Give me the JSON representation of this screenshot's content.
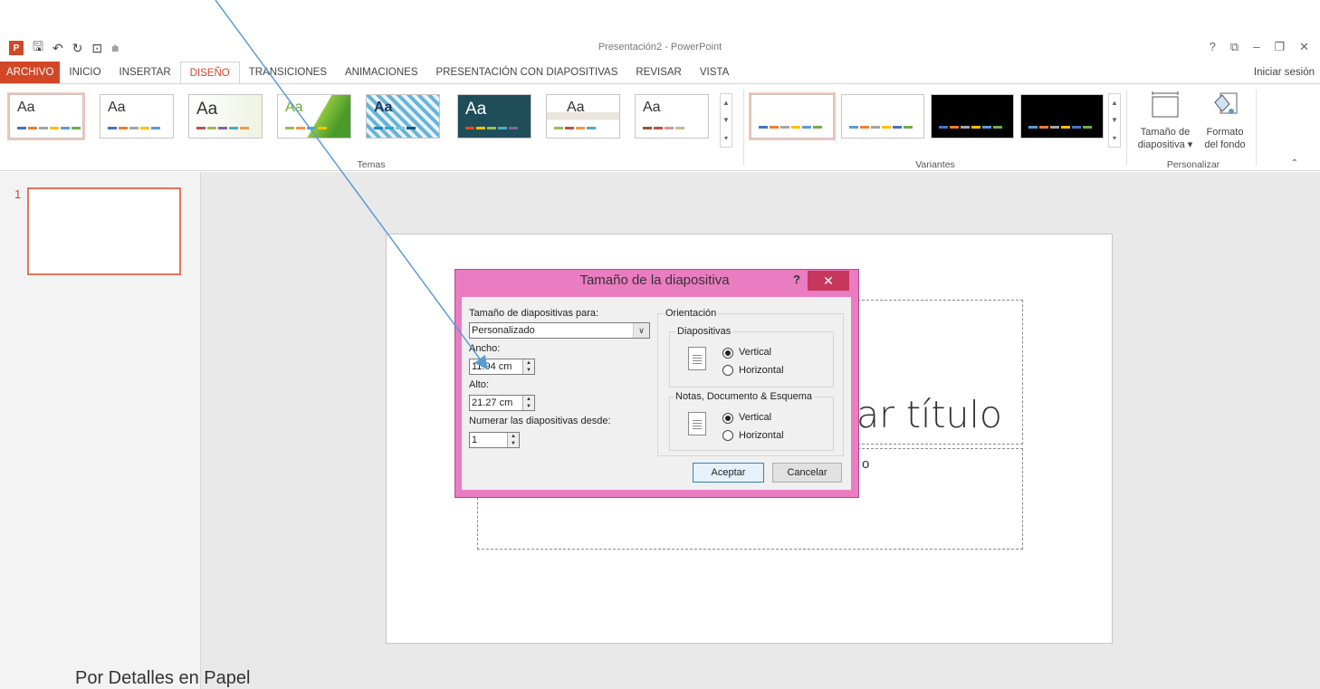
{
  "window": {
    "title": "Presentación2 - PowerPoint",
    "controls": [
      "?",
      "⧉",
      "–",
      "❐",
      "✕"
    ],
    "signin_label": "Iniciar sesión"
  },
  "quick_access": {
    "app_icon": "P",
    "icons": [
      "save-icon",
      "undo-icon",
      "redo-icon",
      "present-icon",
      "customize-icon"
    ]
  },
  "tabs": [
    {
      "label": "ARCHIVO"
    },
    {
      "label": "INICIO"
    },
    {
      "label": "INSERTAR"
    },
    {
      "label": "DISEÑO"
    },
    {
      "label": "TRANSICIONES"
    },
    {
      "label": "ANIMACIONES"
    },
    {
      "label": "PRESENTACIÓN CON DIAPOSITIVAS"
    },
    {
      "label": "REVISAR"
    },
    {
      "label": "VISTA"
    }
  ],
  "ribbon": {
    "themes_label": "Temas",
    "variants_label": "Variantes",
    "customize_label": "Personalizar",
    "theme_aa": "Aa",
    "slide_size_label_1": "Tamaño de",
    "slide_size_label_2": "diapositiva ▾",
    "format_bg_label_1": "Formato",
    "format_bg_label_2": "del fondo"
  },
  "slides_panel": {
    "slide_number": "1"
  },
  "slide": {
    "title_placeholder_visible": "ar título",
    "subtitle_placeholder_visible": "o"
  },
  "dialog": {
    "title": "Tamaño de la diapositiva",
    "help": "?",
    "close": "✕",
    "size_for_label": "Tamaño de diapositivas para:",
    "size_for_value": "Personalizado",
    "width_label": "Ancho:",
    "width_value": "11.94 cm",
    "height_label": "Alto:",
    "height_value": "21.27 cm",
    "number_from_label": "Numerar las diapositivas desde:",
    "number_from_value": "1",
    "orientation_label": "Orientación",
    "slides_group_label": "Diapositivas",
    "notes_group_label": "Notas, Documento & Esquema",
    "vertical_label": "Vertical",
    "horizontal_label": "Horizontal",
    "slides_orientation": "Vertical",
    "notes_orientation": "Vertical",
    "ok_label": "Aceptar",
    "cancel_label": "Cancelar"
  },
  "footnote": "Por Detalles en Papel",
  "colors": {
    "accent": "#d24726",
    "dialog_frame": "#ea7cc1",
    "close_button": "#c7365c",
    "annotation_arrow": "#5b9bd5"
  }
}
